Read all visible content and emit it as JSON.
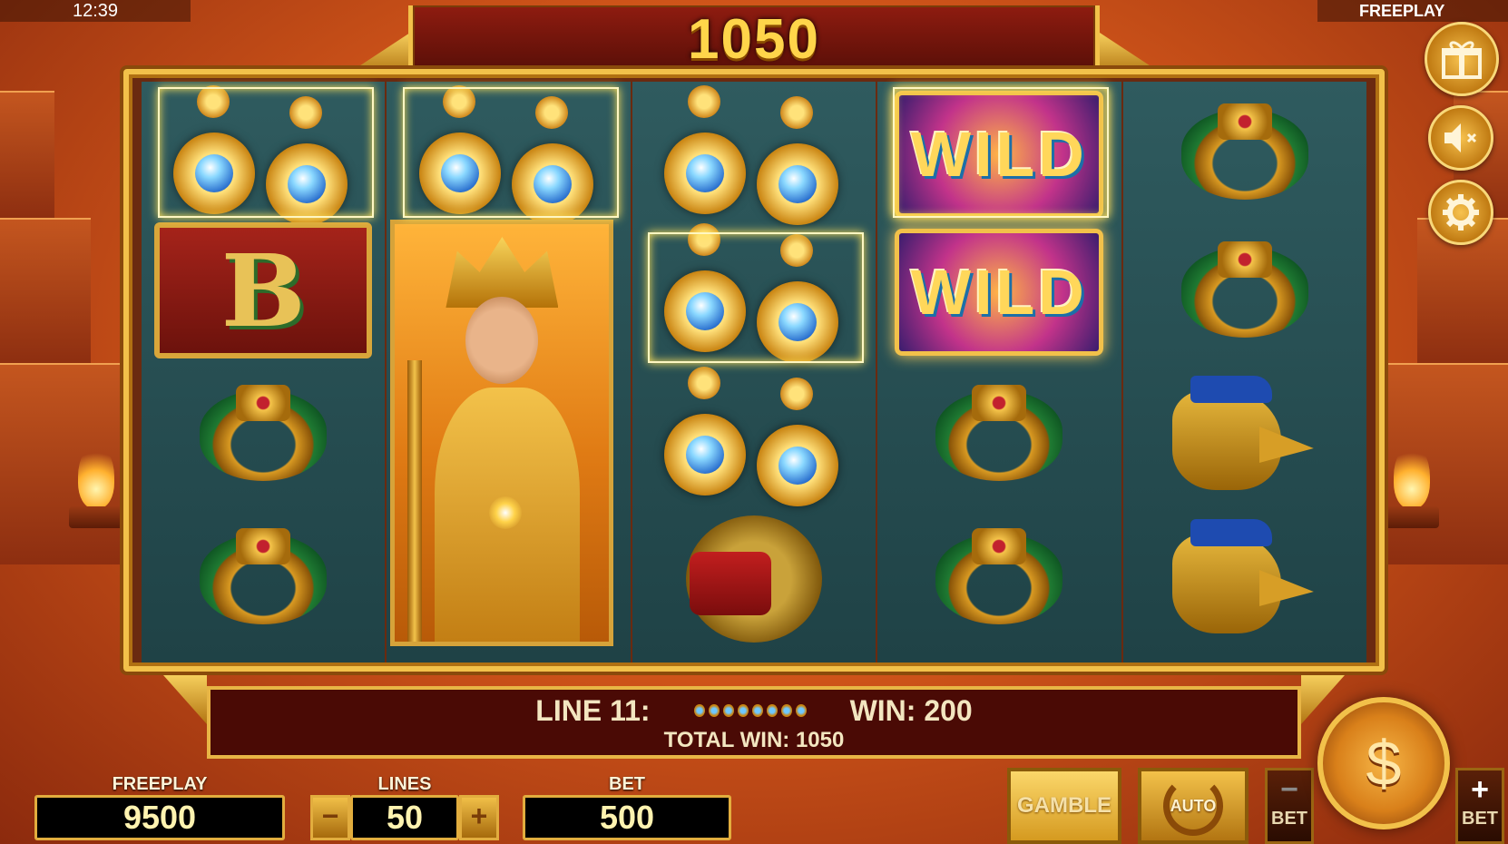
{
  "status": {
    "time": "12:39",
    "mode": "FREEPLAY"
  },
  "win_banner": {
    "amount": "1050"
  },
  "reels": {
    "wild_label": "WILD",
    "bonus_label": "B"
  },
  "info_bar": {
    "line_label": "LINE 11:",
    "win_label": "WIN: 200",
    "total_label": "TOTAL WIN: 1050"
  },
  "meters": {
    "freeplay": {
      "caption": "FREEPLAY",
      "value": "9500"
    },
    "lines": {
      "caption": "LINES",
      "value": "50",
      "minus": "−",
      "plus": "+"
    },
    "bet": {
      "caption": "BET",
      "value": "500"
    }
  },
  "buttons": {
    "gamble": "GAMBLE",
    "auto": "AUTO",
    "bet_minus_symbol": "−",
    "bet_minus_caption": "BET",
    "bet_plus_symbol": "+",
    "bet_plus_caption": "BET"
  },
  "icons": {
    "gift": "gift-icon",
    "sound": "sound-muted-icon",
    "settings": "gear-icon",
    "spin": "money-bag-icon"
  },
  "colors": {
    "accent_gold": "#f2c14a",
    "panel_dark": "#4a0a05",
    "reel_bg": "#2f5b5f"
  }
}
